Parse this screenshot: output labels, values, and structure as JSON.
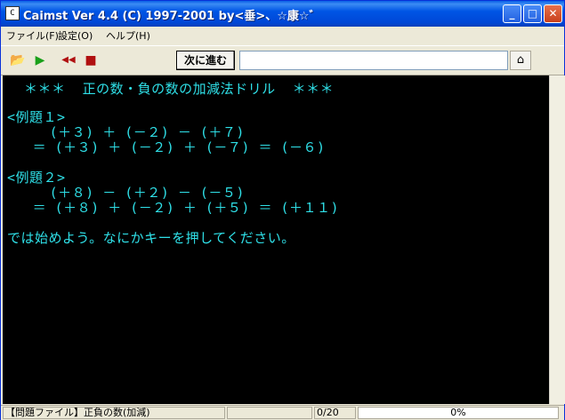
{
  "window": {
    "title": "Caimst Ver 4.4 (C) 1997-2001  by<垂>、☆康☆゛",
    "icon_label": "C",
    "minimize_glyph": "_",
    "maximize_glyph": "□",
    "close_glyph": "✕"
  },
  "menu": {
    "file": "ファイル(F)",
    "settings": "設定(O)",
    "help": "ヘルプ(H)"
  },
  "toolbar": {
    "open_icon": "folder-open-icon",
    "play_icon": "play-icon",
    "rewind_icon": "rewind-icon",
    "stop_icon": "stop-icon",
    "next_button": "次に進む",
    "answer_value": "",
    "help_icon": "help-book-icon",
    "open_glyph": "📂",
    "play_glyph": "▶",
    "rewind_glyph": "◀◀",
    "stop_glyph": "■",
    "help_glyph": "⌂"
  },
  "console": {
    "lines": [
      "  ＊＊＊  正の数・負の数の加減法ドリル  ＊＊＊",
      "",
      "<例題１>",
      "     (＋３) ＋ (－２) － (＋７)",
      "   ＝ (＋３) ＋ (－２) ＋ (－７) ＝ (－６)",
      "",
      "<例題２>",
      "     (＋８) － (＋２) － (－５)",
      "   ＝ (＋８) ＋ (－２) ＋ (＋５) ＝ (＋１１)",
      "",
      "では始めよう。なにかキーを押してください。"
    ]
  },
  "status": {
    "problem_file": "【問題ファイル】正負の数(加減)",
    "count": "0/20",
    "progress_percent": "0%",
    "progress_value": 0
  },
  "colors": {
    "console_text": "#2fe0e8",
    "console_bg": "#000000"
  }
}
